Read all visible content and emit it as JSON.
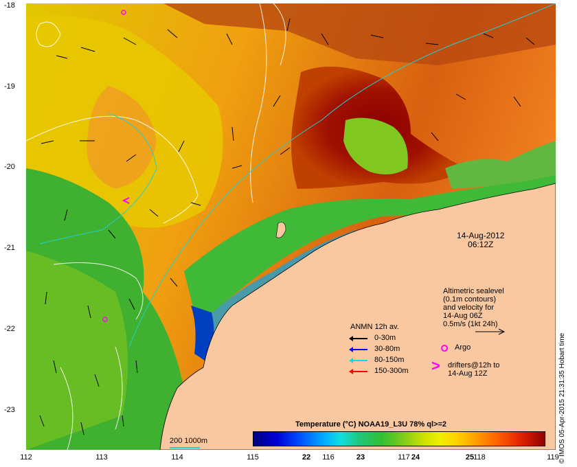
{
  "map": {
    "x_ticks": [
      "112",
      "113",
      "114",
      "115",
      "116",
      "117",
      "118",
      "119"
    ],
    "y_ticks": [
      "-18",
      "-19",
      "-20",
      "-21",
      "-22",
      "-23"
    ],
    "timestamp_date": "14-Aug-2012",
    "timestamp_time": "06:12Z",
    "altimetry_note": [
      "Altimetric sealevel",
      "(0.1m contours)",
      "and velocity for",
      "14-Aug 06Z",
      "0.5m/s (1kt 24h)"
    ],
    "legend": {
      "title": "ANMN 12h av.",
      "rows": [
        {
          "label": "0-30m",
          "color": "#000000"
        },
        {
          "label": "30-80m",
          "color": "#0000ff"
        },
        {
          "label": "80-150m",
          "color": "#00e0e0"
        },
        {
          "label": "150-300m",
          "color": "#ff0000"
        }
      ],
      "argo_label": "Argo",
      "drifter_label": [
        "drifters@12h to",
        "14-Aug 12Z"
      ]
    },
    "colorbar": {
      "title": "Temperature (°C) NOAA19_L3U 78% ql>=2",
      "ticks": [
        "22",
        "23",
        "24",
        "25"
      ]
    },
    "scale_label": "200  1000m",
    "credit": "© IMOS 05-Apr-2015 21:31:35 Hobart time",
    "colors": {
      "land": "#f9c8a0",
      "contour": "#ffffff",
      "isobath": "#20d0d0",
      "arrow": "#000000"
    }
  }
}
